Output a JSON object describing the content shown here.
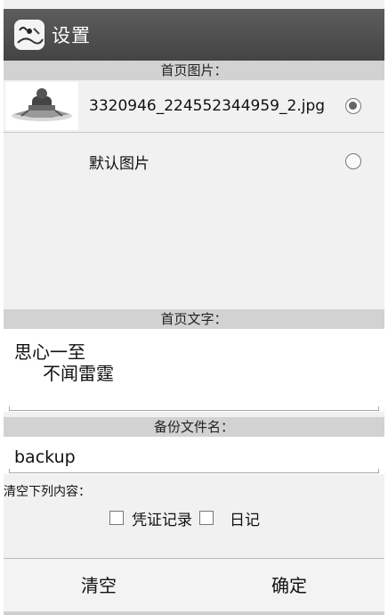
{
  "title_bar": {
    "title": "设置",
    "icon": "app-logo-icon"
  },
  "image_section": {
    "header": "首页图片：",
    "options": [
      {
        "label": "3320946_224552344959_2.jpg",
        "selected": true,
        "thumbnail": "image-thumbnail"
      },
      {
        "label": "默认图片",
        "selected": false
      }
    ]
  },
  "text_section": {
    "header": "首页文字：",
    "line1": "思心一至",
    "line2": "不闻雷霆"
  },
  "backup_section": {
    "header": "备份文件名：",
    "value": "backup"
  },
  "clear_section": {
    "label": "清空下列内容：",
    "options": [
      {
        "label": "凭证记录",
        "checked": false
      },
      {
        "label": "日记",
        "checked": false
      }
    ]
  },
  "buttons": {
    "clear": "清空",
    "confirm": "确定"
  },
  "colors": {
    "titlebar": "#4f4f4f",
    "section_header": "#d2d2d2",
    "background": "#f1f1f1"
  }
}
